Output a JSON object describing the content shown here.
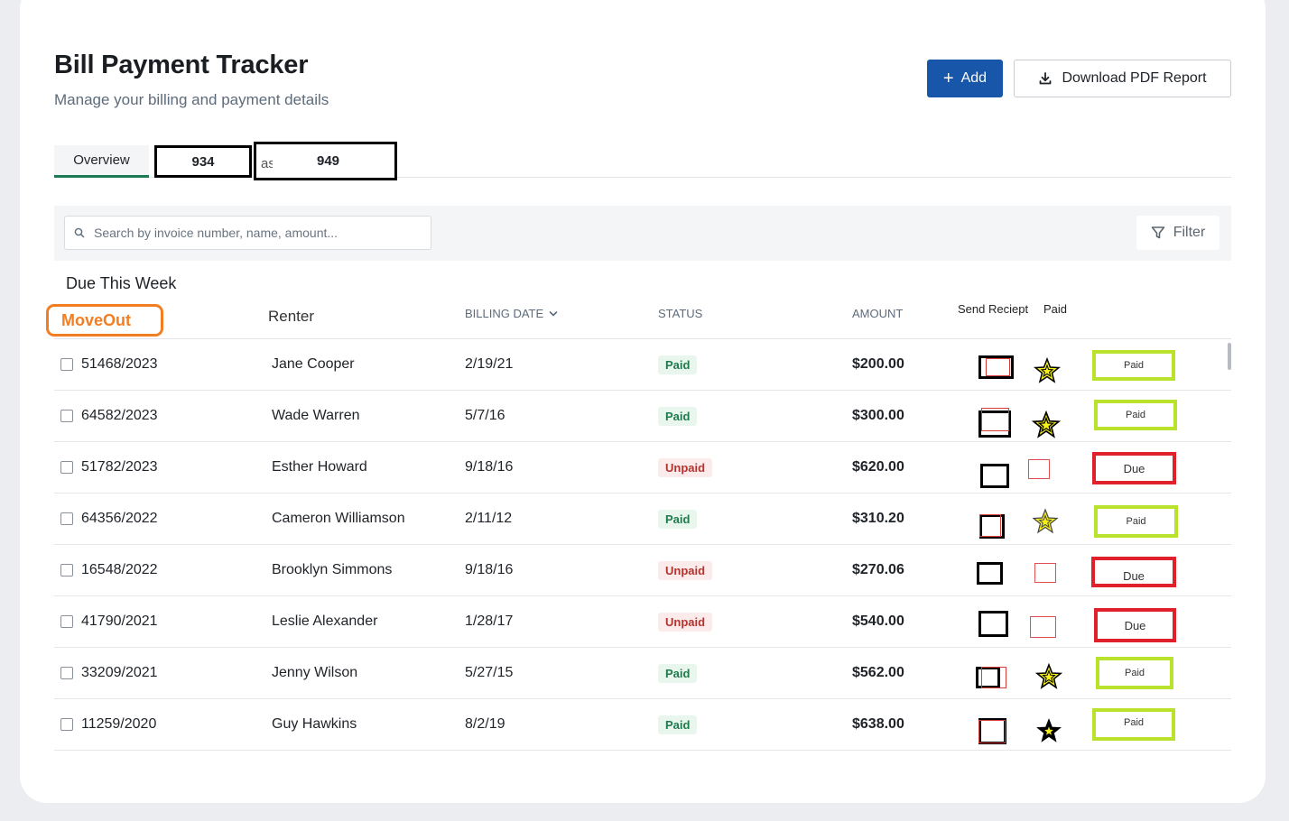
{
  "header": {
    "title": "Bill Payment Tracker",
    "subtitle": "Manage your billing and payment details",
    "add_label": "Add",
    "download_label": "Download PDF Report"
  },
  "tabs": {
    "overview": "Overview",
    "box1": "934",
    "box2_partial": "as",
    "box2": "949"
  },
  "search": {
    "placeholder": "Search by invoice number, name, amount..."
  },
  "filter_label": "Filter",
  "section_title": "Due This Week",
  "columns": {
    "moveout": "MoveOut",
    "renter": "Renter",
    "billing_date": "BILLING DATE",
    "status": "STATUS",
    "amount": "AMOUNT",
    "send_receipt": "Send Reciept",
    "paid": "Paid"
  },
  "rows": [
    {
      "invoice": "51468/2023",
      "renter": "Jane Cooper",
      "date": "2/19/21",
      "status": "Paid",
      "amount": "$200.00",
      "paid_mark": "star",
      "badge": "Paid"
    },
    {
      "invoice": "64582/2023",
      "renter": "Wade Warren",
      "date": "5/7/16",
      "status": "Paid",
      "amount": "$300.00",
      "paid_mark": "star",
      "badge": "Paid"
    },
    {
      "invoice": "51782/2023",
      "renter": "Esther Howard",
      "date": "9/18/16",
      "status": "Unpaid",
      "amount": "$620.00",
      "paid_mark": "box",
      "badge": "Due"
    },
    {
      "invoice": "64356/2022",
      "renter": "Cameron Williamson",
      "date": "2/11/12",
      "status": "Paid",
      "amount": "$310.20",
      "paid_mark": "star",
      "badge": "Paid"
    },
    {
      "invoice": "16548/2022",
      "renter": "Brooklyn Simmons",
      "date": "9/18/16",
      "status": "Unpaid",
      "amount": "$270.06",
      "paid_mark": "box",
      "badge": "Due"
    },
    {
      "invoice": "41790/2021",
      "renter": "Leslie Alexander",
      "date": "1/28/17",
      "status": "Unpaid",
      "amount": "$540.00",
      "paid_mark": "box",
      "badge": "Due"
    },
    {
      "invoice": "33209/2021",
      "renter": "Jenny Wilson",
      "date": "5/27/15",
      "status": "Paid",
      "amount": "$562.00",
      "paid_mark": "star",
      "badge": "Paid"
    },
    {
      "invoice": "11259/2020",
      "renter": "Guy Hawkins",
      "date": "8/2/19",
      "status": "Paid",
      "amount": "$638.00",
      "paid_mark": "star",
      "badge": "Paid"
    }
  ],
  "colors": {
    "primary": "#1756a9",
    "tab_active": "#1e7a52",
    "moveout": "#f37e22",
    "badge_paid": "#b8e22b",
    "badge_due": "#e0202a",
    "star_fill": "#f5ef1a"
  }
}
